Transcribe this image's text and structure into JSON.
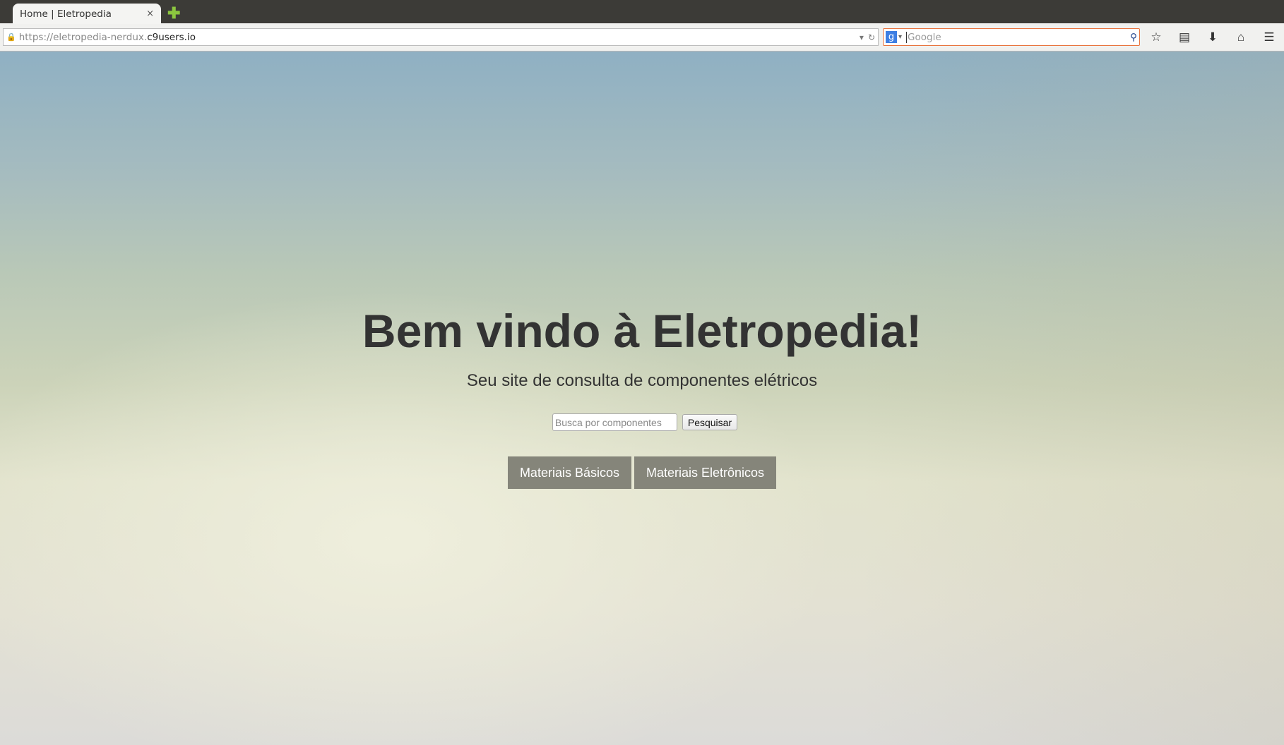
{
  "browser": {
    "tab_title": "Home | Eletropedia",
    "tab_close": "×",
    "new_tab": "✚",
    "url_scheme": "https://eletropedia-nerdux.",
    "url_host": "c9users.io",
    "search_engine_icon": "g",
    "search_placeholder": "Google"
  },
  "page": {
    "title": "Bem vindo à Eletropedia!",
    "subtitle": "Seu site de consulta de componentes elétricos",
    "search_placeholder": "Busca por componentes",
    "search_button": "Pesquisar",
    "buttons": [
      "Materiais Básicos",
      "Materiais Eletrônicos"
    ]
  }
}
